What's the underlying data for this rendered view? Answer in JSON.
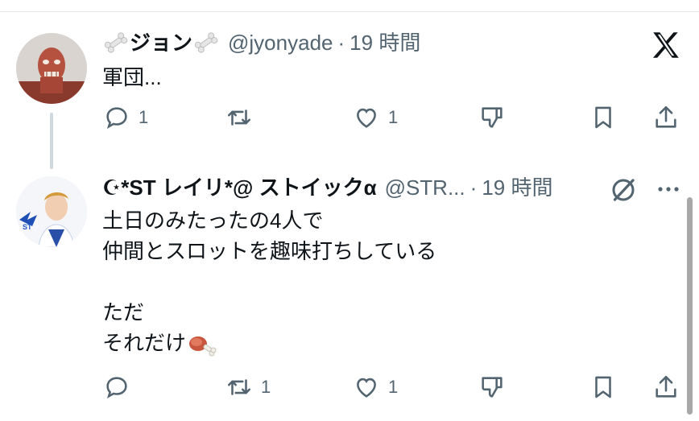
{
  "tweets": [
    {
      "display_name": "ジョン",
      "handle": "@jyonyade",
      "separator": "·",
      "time": "19 時間",
      "body": "軍団...",
      "actions": {
        "reply_count": "1",
        "retweet_count": "",
        "like_count": "1"
      },
      "icons": {
        "name_left": "bone-icon",
        "name_right": "bone-icon",
        "top_right": "x-logo-icon"
      }
    },
    {
      "display_name": "☪*ST レイリ*@ ストイックα",
      "handle": "@STR...",
      "separator": "·",
      "time": "19 時間",
      "body_lines": [
        "土日のみたったの4人で",
        "仲間とスロットを趣味打ちしている",
        "",
        "ただ",
        "それだけ"
      ],
      "trailing_emoji": "meat-on-bone-icon",
      "actions": {
        "reply_count": "",
        "retweet_count": "1",
        "like_count": "1"
      },
      "icons": {
        "top_right": "grok-icon",
        "more": "more-icon"
      }
    }
  ],
  "colors": {
    "text": "#0f1419",
    "secondary": "#536471",
    "thread_line": "#cfd9de",
    "divider": "#e6e9eb"
  }
}
